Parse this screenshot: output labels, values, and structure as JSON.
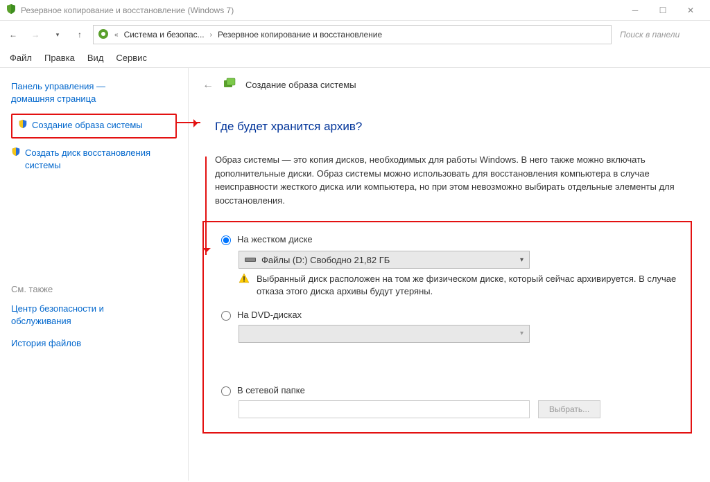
{
  "window": {
    "title": "Резервное копирование и восстановление (Windows 7)"
  },
  "breadcrumb": {
    "part1": "Система и безопас...",
    "part2": "Резервное копирование и восстановление"
  },
  "search_placeholder": "Поиск в панели",
  "menubar": {
    "file": "Файл",
    "edit": "Правка",
    "view": "Вид",
    "service": "Сервис"
  },
  "sidebar": {
    "home1": "Панель управления —",
    "home2": "домашняя страница",
    "create_image": "Создание образа системы",
    "create_disc1": "Создать диск восстановления",
    "create_disc2": "системы",
    "also_title": "См. также",
    "security1": "Центр безопасности и",
    "security2": "обслуживания",
    "history": "История файлов"
  },
  "main": {
    "header": "Создание образа системы",
    "question": "Где будет хранится архив?",
    "description": "Образ системы — это копия дисков, необходимых для работы Windows. В него также можно включать дополнительные диски. Образ системы можно использовать для восстановления компьютера в случае неисправности жесткого диска или компьютера, но при этом невозможно выбирать отдельные элементы для восстановления.",
    "opt_disk": "На жестком диске",
    "disk_value": "Файлы (D:)  Свободно 21,82 ГБ",
    "warn_text": "Выбранный диск расположен на том же физическом диске, который сейчас архивируется. В случае отказа этого диска архивы будут утеряны.",
    "opt_dvd": "На DVD-дисках",
    "opt_net": "В сетевой папке",
    "browse": "Выбрать..."
  }
}
